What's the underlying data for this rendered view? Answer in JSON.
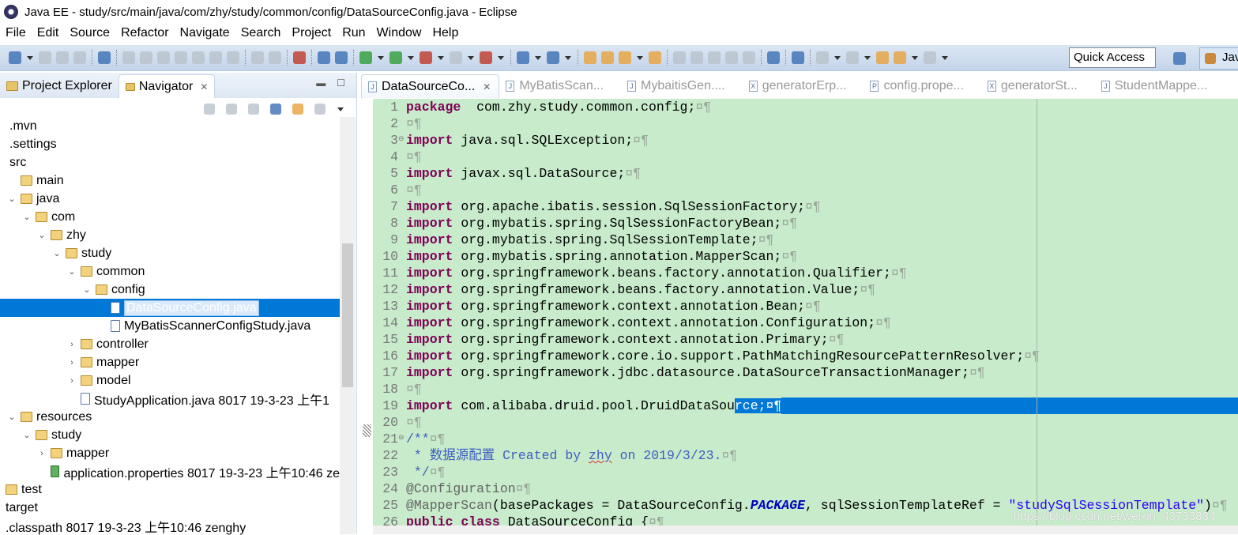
{
  "window": {
    "title": "Java EE - study/src/main/java/com/zhy/study/common/config/DataSourceConfig.java - Eclipse"
  },
  "menu": [
    "File",
    "Edit",
    "Source",
    "Refactor",
    "Navigate",
    "Search",
    "Project",
    "Run",
    "Window",
    "Help"
  ],
  "toolbar": {
    "quick_access": "Quick Access",
    "perspective": "Java"
  },
  "left_panel": {
    "tabs": [
      {
        "label": "Project Explorer",
        "active": false
      },
      {
        "label": "Navigator",
        "active": true
      }
    ],
    "tree": [
      {
        "label": ".mvn",
        "depth": 0,
        "twisty": "",
        "icon": ""
      },
      {
        "label": ".settings",
        "depth": 0,
        "twisty": "",
        "icon": ""
      },
      {
        "label": "src",
        "depth": 0,
        "twisty": "",
        "icon": ""
      },
      {
        "label": "main",
        "depth": 0,
        "twisty": "",
        "icon": "pkg"
      },
      {
        "label": "java",
        "depth": 0,
        "twisty": "⌄",
        "icon": "pkg"
      },
      {
        "label": "com",
        "depth": 1,
        "twisty": "⌄",
        "icon": "pkg"
      },
      {
        "label": "zhy",
        "depth": 2,
        "twisty": "⌄",
        "icon": "pkg"
      },
      {
        "label": "study",
        "depth": 3,
        "twisty": "⌄",
        "icon": "pkg"
      },
      {
        "label": "common",
        "depth": 4,
        "twisty": "⌄",
        "icon": "pkg"
      },
      {
        "label": "config",
        "depth": 5,
        "twisty": "⌄",
        "icon": "pkg"
      },
      {
        "label": "DataSourceConfig.java",
        "depth": 6,
        "twisty": "",
        "icon": "java",
        "selected": true
      },
      {
        "label": "MyBatisScannerConfigStudy.java",
        "depth": 6,
        "twisty": "",
        "icon": "java"
      },
      {
        "label": "controller",
        "depth": 4,
        "twisty": "›",
        "icon": "pkg"
      },
      {
        "label": "mapper",
        "depth": 4,
        "twisty": "›",
        "icon": "pkg"
      },
      {
        "label": "model",
        "depth": 4,
        "twisty": "›",
        "icon": "pkg"
      },
      {
        "label": "StudyApplication.java 8017  19-3-23 上午1",
        "depth": 4,
        "twisty": "",
        "icon": "java"
      },
      {
        "label": "resources",
        "depth": 0,
        "twisty": "⌄",
        "icon": "pkg"
      },
      {
        "label": "study",
        "depth": 1,
        "twisty": "⌄",
        "icon": "pkg"
      },
      {
        "label": "mapper",
        "depth": 2,
        "twisty": "›",
        "icon": "pkg"
      },
      {
        "label": "application.properties 8017  19-3-23 上午10:46  ze",
        "depth": 2,
        "twisty": "",
        "icon": "prop"
      },
      {
        "label": "test",
        "depth": -1,
        "twisty": "",
        "icon": "pkg"
      },
      {
        "label": "target",
        "depth": -1,
        "twisty": "",
        "icon": ""
      },
      {
        "label": ".classpath 8017  19-3-23 上午10:46  zenghy",
        "depth": -1,
        "twisty": "",
        "icon": ""
      }
    ]
  },
  "editor": {
    "tabs": [
      {
        "label": "DataSourceCo...",
        "icon": "J",
        "active": true
      },
      {
        "label": "MyBatisScan...",
        "icon": "J"
      },
      {
        "label": "MybaitisGen....",
        "icon": "J"
      },
      {
        "label": "generatorErp...",
        "icon": "X"
      },
      {
        "label": "config.prope...",
        "icon": "P"
      },
      {
        "label": "generatorSt...",
        "icon": "X"
      },
      {
        "label": "StudentMappe...",
        "icon": "J"
      }
    ],
    "eol_marker": "¤¶",
    "lines": [
      {
        "n": "1",
        "t": [
          [
            "kw",
            "package"
          ],
          [
            "",
            "  com.zhy.study.common.config;"
          ]
        ]
      },
      {
        "n": "2",
        "t": []
      },
      {
        "n": "3",
        "fold": true,
        "t": [
          [
            "kw",
            "import"
          ],
          [
            "",
            " java.sql.SQLException;"
          ]
        ]
      },
      {
        "n": "4",
        "t": []
      },
      {
        "n": "5",
        "t": [
          [
            "kw",
            "import"
          ],
          [
            "",
            " javax.sql.DataSource;"
          ]
        ]
      },
      {
        "n": "6",
        "t": []
      },
      {
        "n": "7",
        "t": [
          [
            "kw",
            "import"
          ],
          [
            "",
            " org.apache.ibatis.session.SqlSessionFactory;"
          ]
        ]
      },
      {
        "n": "8",
        "t": [
          [
            "kw",
            "import"
          ],
          [
            "",
            " org.mybatis.spring.SqlSessionFactoryBean;"
          ]
        ]
      },
      {
        "n": "9",
        "t": [
          [
            "kw",
            "import"
          ],
          [
            "",
            " org.mybatis.spring.SqlSessionTemplate;"
          ]
        ]
      },
      {
        "n": "10",
        "t": [
          [
            "kw",
            "import"
          ],
          [
            "",
            " org.mybatis.spring.annotation.MapperScan;"
          ]
        ]
      },
      {
        "n": "11",
        "t": [
          [
            "kw",
            "import"
          ],
          [
            "",
            " org.springframework.beans.factory.annotation.Qualifier;"
          ]
        ]
      },
      {
        "n": "12",
        "t": [
          [
            "kw",
            "import"
          ],
          [
            "",
            " org.springframework.beans.factory.annotation.Value;"
          ]
        ]
      },
      {
        "n": "13",
        "t": [
          [
            "kw",
            "import"
          ],
          [
            "",
            " org.springframework.context.annotation.Bean;"
          ]
        ]
      },
      {
        "n": "14",
        "t": [
          [
            "kw",
            "import"
          ],
          [
            "",
            " org.springframework.context.annotation.Configuration;"
          ]
        ]
      },
      {
        "n": "15",
        "t": [
          [
            "kw",
            "import"
          ],
          [
            "",
            " org.springframework.context.annotation.Primary;"
          ]
        ]
      },
      {
        "n": "16",
        "t": [
          [
            "kw",
            "import"
          ],
          [
            "",
            " org.springframework.core.io.support.PathMatchingResourcePatternResolver;"
          ]
        ]
      },
      {
        "n": "17",
        "t": [
          [
            "kw",
            "import"
          ],
          [
            "",
            " org.springframework.jdbc.datasource.DataSourceTransactionManager;"
          ]
        ]
      },
      {
        "n": "18",
        "t": []
      },
      {
        "n": "19",
        "selected": true,
        "t": [
          [
            "kw",
            "import"
          ],
          [
            "",
            " com.alibaba.druid.pool.DruidDataSou"
          ],
          [
            "sel",
            "rce;"
          ]
        ]
      },
      {
        "n": "20",
        "t": []
      },
      {
        "n": "21",
        "fold": true,
        "t": [
          [
            "doc",
            "/**"
          ]
        ]
      },
      {
        "n": "22",
        "t": [
          [
            "doc",
            " * 数据源配置 Created by "
          ],
          [
            "doc spell",
            "zhy"
          ],
          [
            "doc",
            " on 2019/3/23."
          ]
        ]
      },
      {
        "n": "23",
        "t": [
          [
            "doc",
            " */"
          ]
        ]
      },
      {
        "n": "24",
        "t": [
          [
            "ann",
            "@Configuration"
          ]
        ]
      },
      {
        "n": "25",
        "t": [
          [
            "ann",
            "@MapperScan"
          ],
          [
            "",
            "(basePackages = DataSourceConfig."
          ],
          [
            "sf",
            "PACKAGE"
          ],
          [
            "",
            ", sqlSessionTemplateRef = "
          ],
          [
            "str",
            "\"studySqlSessionTemplate\""
          ],
          [
            "",
            ")"
          ]
        ]
      },
      {
        "n": "26",
        "t": [
          [
            "kw",
            "public"
          ],
          [
            "",
            " "
          ],
          [
            "kw",
            "class"
          ],
          [
            "",
            " DataSourceConfig {"
          ]
        ]
      }
    ]
  },
  "watermark": "https://blog.csdn.net/weixin_43733834"
}
